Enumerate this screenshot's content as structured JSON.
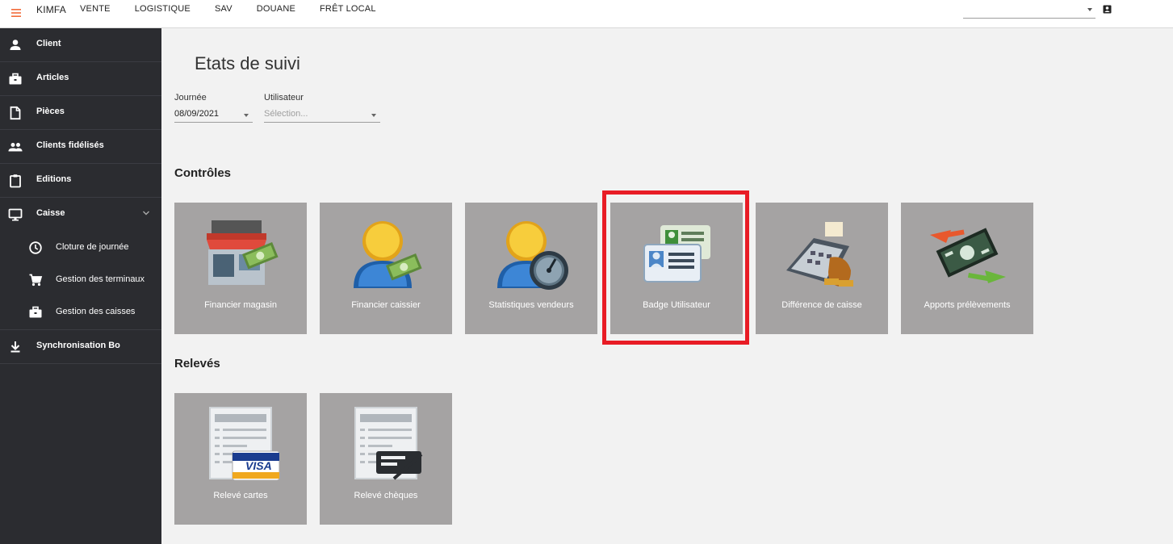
{
  "topbar": {
    "brand": "KIMFA",
    "nav": [
      "VENTE",
      "LOGISTIQUE",
      "SAV",
      "DOUANE",
      "FRÊT LOCAL"
    ],
    "icons": {
      "menu": "hamburger-menu-icon",
      "account": "account-box-icon"
    },
    "accent_color": "#f26b3a"
  },
  "sidebar": {
    "items": [
      {
        "label": "Client",
        "icon": "person-icon"
      },
      {
        "label": "Articles",
        "icon": "briefcase-icon"
      },
      {
        "label": "Pièces",
        "icon": "document-icon"
      },
      {
        "label": "Clients fidélisés",
        "icon": "people-icon"
      },
      {
        "label": "Editions",
        "icon": "clipboard-icon"
      },
      {
        "label": "Caisse",
        "icon": "monitor-icon",
        "expanded": true
      }
    ],
    "sub_items": [
      {
        "label": "Cloture de journée",
        "icon": "clock-icon"
      },
      {
        "label": "Gestion des terminaux",
        "icon": "cart-icon"
      },
      {
        "label": "Gestion des caisses",
        "icon": "briefcase-icon"
      }
    ],
    "bottom_item": {
      "label": "Synchronisation Bo",
      "icon": "download-icon"
    }
  },
  "main": {
    "title": "Etats de suivi",
    "filters": {
      "journee_label": "Journée",
      "journee_value": "08/09/2021",
      "utilisateur_label": "Utilisateur",
      "utilisateur_placeholder": "Sélection..."
    },
    "controles": {
      "title": "Contrôles",
      "tiles": [
        {
          "label": "Financier magasin",
          "icon": "store-money-icon"
        },
        {
          "label": "Financier caissier",
          "icon": "cashier-money-icon"
        },
        {
          "label": "Statistiques vendeurs",
          "icon": "seller-gauge-icon"
        },
        {
          "label": "Badge Utilisateur",
          "icon": "id-badge-icon",
          "highlighted": true
        },
        {
          "label": "Différence de caisse",
          "icon": "cash-register-icon"
        },
        {
          "label": "Apports prélèvements",
          "icon": "money-exchange-icon"
        }
      ]
    },
    "releves": {
      "title": "Relevés",
      "tiles": [
        {
          "label": "Relevé cartes",
          "icon": "visa-statement-icon",
          "card_text": "VISA"
        },
        {
          "label": "Relevé chèques",
          "icon": "cheque-statement-icon"
        }
      ]
    },
    "highlight_color": "#e81c25"
  }
}
